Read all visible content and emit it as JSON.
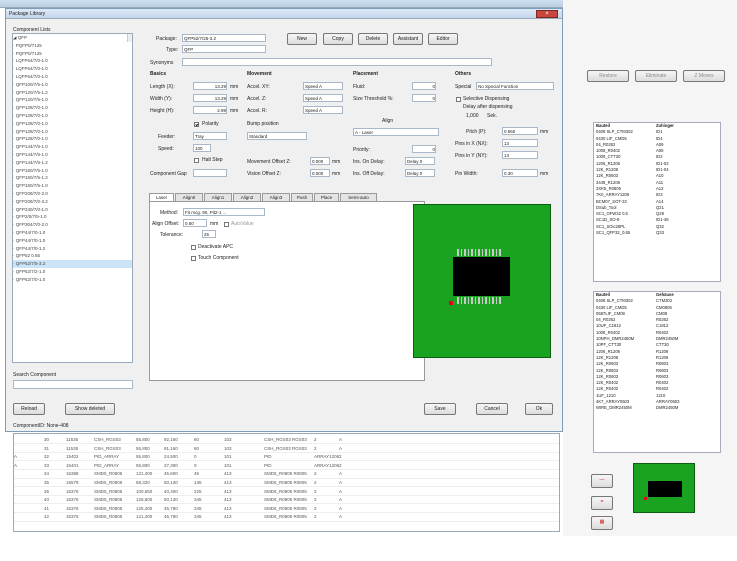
{
  "window": {
    "title": "Package Library",
    "close": "×"
  },
  "tree": {
    "header": "Component Lists",
    "items": [
      "◢ QFP",
      "  · PQFP0/7125",
      "  · PQFP0/7125",
      "  · LQFP64/7/0-1.0",
      "  · LQFP64/7/0-1.0",
      "  · LQFP64/7/0-1.0",
      "  · QFP100/7/5-1.0",
      "  · QFP120/7/5-1.2",
      "  · QFP120/7/5-1.0",
      "  · QFP128/7/0-1.0",
      "  · QFP128/7/0-1.0",
      "  · QFP128/7/0-1.0",
      "  · QFP128/7/0-1.0",
      "  · QFP128/7/0-1.0",
      "  · QFP144/7/5-1.0",
      "  · QFP144/7/5-1.0",
      "  · QFP144/7/5-1.2",
      "  · QFP160/7/5-1.0",
      "  · QFP160/7/5-1.2",
      "  · QFP160/7/5-1.0",
      "  · QFP208/7/0-2.0",
      "  · QFP208/7/0-3.2",
      "  · QFP240/7/0-1.0",
      "  · QFP2/0/7/5-1.0",
      "  · QFP304/7/0-2.0",
      "  · QFP44/7/0-1.0",
      "  · QFP44/7/0-1.0",
      "  · QFP44/7/0-1.2",
      "  · QFP52 0.65",
      "  · QFP52/7/5-3.2",
      "  · QFP52/7/2-1.0",
      "  · QFP52/7/0-1.0"
    ],
    "selected": 29
  },
  "search": {
    "label": "Search Component",
    "placeholder": ""
  },
  "form": {
    "package_label": "Package:",
    "package": "QFP52/7/25-3.2",
    "type_label": "Type:",
    "type": "QFP",
    "synonyms_label": "Synonyms",
    "basics": "Basics",
    "length_label": "Length (X):",
    "length": "13.29",
    "width_label": "Width (Y):",
    "width": "13.29",
    "height_label": "Height (H):",
    "height": "2.99",
    "unit": "mm",
    "polarity": "Polarity",
    "feeder_label": "Feeder:",
    "feeder": "Tray",
    "speed_label": "Speed:",
    "speed": "100",
    "vmstop": "Halt Step",
    "component_gap_label": "Component Gap",
    "component_gap": "",
    "movement": "Movement",
    "accel_xy_label": "Accel. XY:",
    "accel_xy": "Speed A",
    "accel_z_label": "Accel. Z:",
    "accel_z": "Speed A",
    "accel_r_label": "Accel. R:",
    "accel_r": "Speed A",
    "bump": "Bump position",
    "bump_val": "Standard",
    "move_offset_label": "Movement Offset Z:",
    "move_offset": "0.000",
    "vision_offset_label": "Vision Offset Z:",
    "vision_offset": "0.000",
    "mm": "mm",
    "placement": "Placement",
    "fluid_label": "Fluid:",
    "fluid": "0",
    "size_threshold_label": "Size Threshold %:",
    "size_threshold": "0",
    "align": "Align",
    "align_val": "A - Laser",
    "priority_label": "Priority:",
    "priority": "0",
    "ins_delay_label": "Ins. On Delay:",
    "ins_delay": "Delay 0",
    "ins_off_label": "Ins. Off Delay:",
    "ins_off": "Delay 0",
    "others": "Others",
    "special_label": "Special",
    "special": "No Special Function",
    "selective": "Selective Dispensing",
    "delay_after": "Delay after dispensing",
    "delay_val": "1,000",
    "sec": "Sek.",
    "pitch_label": "Pitch (P):",
    "pitch": "0.650",
    "pins_x_label": "Pins in X (NX):",
    "pins_x": "13",
    "pins_y_label": "Pins in Y (NY):",
    "pins_y": "13",
    "pin_width_label": "Pin Width:",
    "pin_width": "0.30"
  },
  "buttons": {
    "new": "New",
    "copy": "Copy",
    "delete": "Delete",
    "assistant": "Assistant",
    "editor": "Editor",
    "reload": "Reload",
    "show_deleted": "Show deleted",
    "save": "Save",
    "cancel": "Cancel",
    "ok": "Ok"
  },
  "tabs": [
    "Laser",
    "Align0",
    "Align1",
    "Align2",
    "Align3",
    "Push",
    "Place",
    "Semi-auto"
  ],
  "laser": {
    "method_label": "Method:",
    "method": "Fit mcg. 90, Pit2-1 ...",
    "offset_label": "Align Offset:",
    "offset": "0.60",
    "mm": "mm",
    "autovalue": "AutoValue",
    "tolerance_label": "Tolerance:",
    "tolerance": "25",
    "deactivate": "Deactivate APC",
    "touch": "Touch Component"
  },
  "status": {
    "text": "ComponentID: None-408"
  },
  "grid": {
    "rows": [
      [
        "30",
        "11535",
        "CSH_RGS03",
        "55,800",
        "92,160",
        "60",
        "103",
        "CSH_RGS03 RGS03",
        "2",
        "A"
      ],
      [
        "31",
        "11535",
        "CSH_RGS03",
        "55,800",
        "91,160",
        "60",
        "103",
        "CSH_RGS03 RGS03",
        "2",
        "A"
      ],
      [
        "32",
        "15402",
        "PID_ARRAY",
        "55,800",
        "24,500",
        "0",
        "101",
        "PID",
        "ARRAY1206",
        "2",
        "A"
      ],
      [
        "33",
        "15401",
        "PID_ARRAY",
        "55,800",
        "27,300",
        "0",
        "101",
        "PID",
        "ARRAY1206",
        "2",
        "A"
      ],
      [
        "34",
        "15388",
        "SMD5_R0805",
        "121,400",
        "45,600",
        "45",
        "413",
        "SMD5_R0805 R0805",
        "2",
        "A"
      ],
      [
        "35",
        "15579",
        "SMD5_R0805",
        "58,320",
        "50,130",
        "135",
        "413",
        "SMD5_R0805 R0805",
        "2",
        "A"
      ],
      [
        "36",
        "15376",
        "SMD5_R0805",
        "100,650",
        "40,400",
        "225",
        "413",
        "SMD5_R0805 R0805",
        "2",
        "A"
      ],
      [
        "40",
        "15376",
        "SMD5_R0805",
        "126,600",
        "50,130",
        "345",
        "413",
        "SMD5_R0805 R0805",
        "2",
        "A"
      ],
      [
        "41",
        "15376",
        "SMD5_R0805",
        "125,400",
        "45,780",
        "345",
        "413",
        "SMD5_R0805 R0805",
        "2",
        "A"
      ],
      [
        "42",
        "15375",
        "SMD5_R0805",
        "121,400",
        "46,780",
        "345",
        "413",
        "SMD5_R0805 R0805",
        "2",
        "A"
      ]
    ]
  },
  "right": {
    "buttons": [
      "Restore",
      "Eliminate",
      "Z Moves"
    ],
    "list1_headers": [
      "Bauteil",
      "Zuhinger"
    ],
    "list1": [
      [
        "0408 SLP_CTM302",
        "ID1"
      ],
      [
        "0430 LIF_CMD5",
        "ID4"
      ],
      [
        "04_R0262",
        "A09"
      ],
      [
        "1008_R0402",
        "A08"
      ],
      [
        "1009_CTT30",
        "ID2"
      ],
      [
        "1206_R1206",
        "ID1-02"
      ],
      [
        "12K_R1206",
        "ID1-04"
      ],
      [
        "12K_R0603",
        "A10"
      ],
      [
        "3448_R1206",
        "A11"
      ],
      [
        "3XK5_R0805",
        "A12"
      ],
      [
        "7K0_ARRAY1206",
        "ID3"
      ],
      [
        "BCM07_SOT-23",
        "A14"
      ],
      [
        "DSub_Tool",
        "Q21"
      ],
      [
        "SC1_OFW32 0.5",
        "Q28"
      ],
      [
        "SC1D_SO-8",
        "ID1-48"
      ],
      [
        "SC1_SOic28PL",
        "Q32"
      ],
      [
        "SC1_QFP32_0.65",
        "Q33"
      ]
    ],
    "list2_headers": [
      "Bauteil",
      "Gehäuse"
    ],
    "list2": [
      [
        "0408 SLP_CTM302",
        "CTM302"
      ],
      [
        "0430 LIF_CMD5",
        "CM0805"
      ],
      [
        "0587LIF_CM08",
        "CM08"
      ],
      [
        "04_R0262",
        "R0262"
      ],
      [
        "10UF_C1812",
        "C1812"
      ],
      [
        "1008_R0402",
        "R0402"
      ],
      [
        "10NPH_DMR2450M",
        "DMR2450M"
      ],
      [
        "10PF_CTT30",
        "CTT30"
      ],
      [
        "1206_R1206",
        "R1206"
      ],
      [
        "12K_R1206",
        "R1206"
      ],
      [
        "12K_R0603",
        "R0603"
      ],
      [
        "12K_R0603",
        "R0603"
      ],
      [
        "12K_R0603",
        "R0603"
      ],
      [
        "12K_R0402",
        "R0402"
      ],
      [
        "12K_R0402",
        "R0402"
      ],
      [
        "1UF_1210",
        "1210"
      ],
      [
        "4K7_ARRAY0603",
        "ARRAY0603"
      ],
      [
        "WIRE_DMR2450M",
        "DMR2450M"
      ]
    ],
    "icon_minus": "—",
    "icon_equal": "=",
    "icon_grid": "▦"
  },
  "colors": {
    "board": "#1aa320",
    "marker": "#e8001f",
    "chip": "#000000"
  }
}
